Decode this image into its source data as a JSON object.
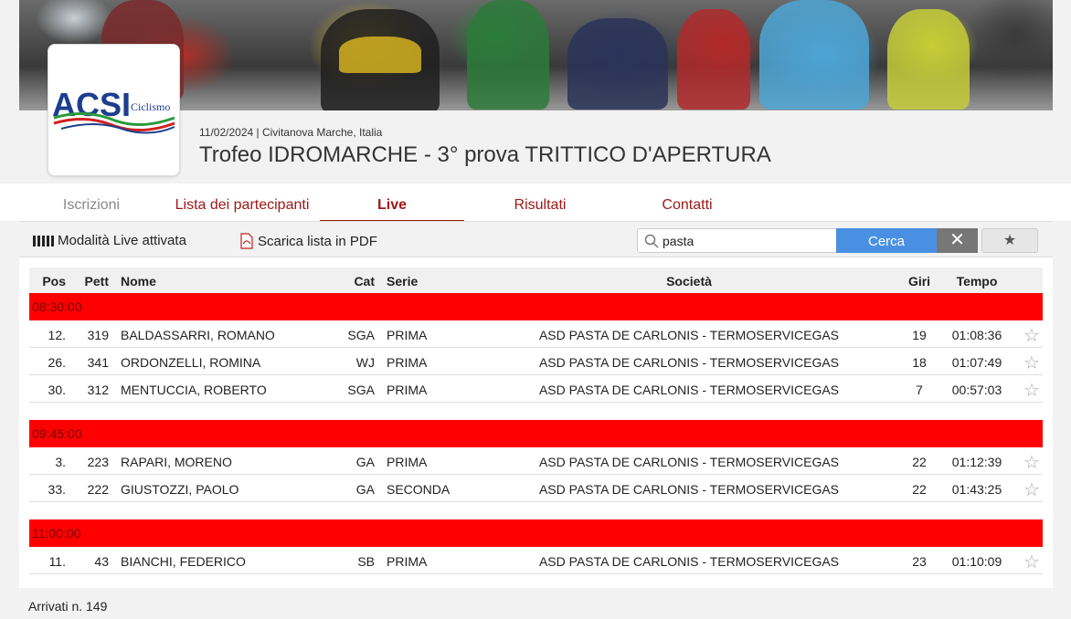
{
  "event": {
    "date": "11/02/2024",
    "location": "Civitanova Marche, Italia",
    "title": "Trofeo IDROMARCHE - 3° prova TRITTICO D'APERTURA"
  },
  "logo": {
    "brand": "ACSI",
    "subtitle": "Ciclismo"
  },
  "tabs": [
    {
      "label": "Iscrizioni",
      "state": "disabled"
    },
    {
      "label": "Lista dei partecipanti",
      "state": "normal"
    },
    {
      "label": "Live",
      "state": "active"
    },
    {
      "label": "Risultati",
      "state": "normal"
    },
    {
      "label": "Contatti",
      "state": "normal"
    }
  ],
  "toolbar": {
    "live_mode_label": "Modalità Live attivata",
    "pdf_label": "Scarica lista in PDF",
    "search_value": "pasta",
    "search_button": "Cerca",
    "clear_button": "✕",
    "favorites_button": "★"
  },
  "table": {
    "headers": {
      "pos": "Pos",
      "pett": "Pett",
      "nome": "Nome",
      "cat": "Cat",
      "serie": "Serie",
      "societa": "Società",
      "giri": "Giri",
      "tempo": "Tempo"
    },
    "groups": [
      {
        "time": "08:30:00",
        "rows": [
          {
            "pos": "12.",
            "pett": "319",
            "nome": "BALDASSARRI, ROMANO",
            "cat": "SGA",
            "serie": "PRIMA",
            "societa": "ASD PASTA DE CARLONIS - TERMOSERVICEGAS",
            "giri": "19",
            "tempo": "01:08:36"
          },
          {
            "pos": "26.",
            "pett": "341",
            "nome": "ORDONZELLI, ROMINA",
            "cat": "WJ",
            "serie": "PRIMA",
            "societa": "ASD PASTA DE CARLONIS - TERMOSERVICEGAS",
            "giri": "18",
            "tempo": "01:07:49"
          },
          {
            "pos": "30.",
            "pett": "312",
            "nome": "MENTUCCIA, ROBERTO",
            "cat": "SGA",
            "serie": "PRIMA",
            "societa": "ASD PASTA DE CARLONIS - TERMOSERVICEGAS",
            "giri": "7",
            "tempo": "00:57:03"
          }
        ]
      },
      {
        "time": "09:45:00",
        "rows": [
          {
            "pos": "3.",
            "pett": "223",
            "nome": "RAPARI, MORENO",
            "cat": "GA",
            "serie": "PRIMA",
            "societa": "ASD PASTA DE CARLONIS - TERMOSERVICEGAS",
            "giri": "22",
            "tempo": "01:12:39"
          },
          {
            "pos": "33.",
            "pett": "222",
            "nome": "GIUSTOZZI, PAOLO",
            "cat": "GA",
            "serie": "SECONDA",
            "societa": "ASD PASTA DE CARLONIS - TERMOSERVICEGAS",
            "giri": "22",
            "tempo": "01:43:25"
          }
        ]
      },
      {
        "time": "11:00:00",
        "rows": [
          {
            "pos": "11.",
            "pett": "43",
            "nome": "BIANCHI, FEDERICO",
            "cat": "SB",
            "serie": "PRIMA",
            "societa": "ASD PASTA DE CARLONIS - TERMOSERVICEGAS",
            "giri": "23",
            "tempo": "01:10:09"
          }
        ]
      }
    ]
  },
  "footer": {
    "arrived": "Arrivati n. 149"
  },
  "colors": {
    "accent_red": "#a01818",
    "group_bar": "#ff0000",
    "search_blue": "#4a90e2"
  }
}
